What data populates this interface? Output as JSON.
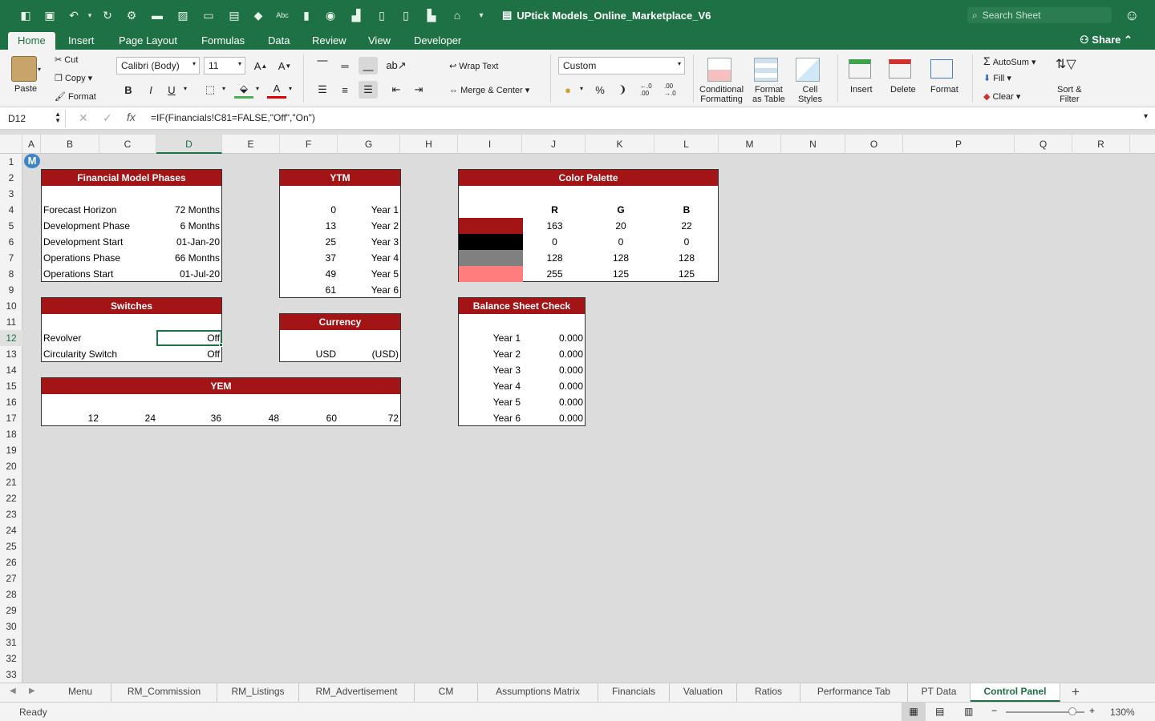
{
  "window": {
    "title": "UPtick Models_Online_Marketplace_V6",
    "search_placeholder": "Search Sheet"
  },
  "ribbon_tabs": [
    "Home",
    "Insert",
    "Page Layout",
    "Formulas",
    "Data",
    "Review",
    "View",
    "Developer"
  ],
  "active_tab": "Home",
  "share_label": "Share",
  "clipboard": {
    "paste": "Paste",
    "cut": "Cut",
    "copy": "Copy",
    "format": "Format"
  },
  "font": {
    "name": "Calibri (Body)",
    "size": "11",
    "bold": "B",
    "italic": "I",
    "underline": "U"
  },
  "alignment": {
    "wrap_text": "Wrap Text",
    "merge_center": "Merge & Center"
  },
  "number": {
    "format": "Custom",
    "percent": "%",
    "comma": "❩",
    "inc_decimal": "←.0 .00",
    "dec_decimal": ".00 →.0"
  },
  "styles": {
    "conditional": "Conditional\nFormatting",
    "format_table": "Format\nas Table",
    "cell_styles": "Cell\nStyles"
  },
  "cells_group": {
    "insert": "Insert",
    "delete": "Delete",
    "format": "Format"
  },
  "editing": {
    "autosum": "AutoSum",
    "fill": "Fill",
    "clear": "Clear",
    "sort_filter": "Sort &\nFilter"
  },
  "formula_bar": {
    "name_box": "D12",
    "fx": "fx",
    "formula": "=IF(Financials!C81=FALSE,\"Off\",\"On\")"
  },
  "columns": [
    "A",
    "B",
    "C",
    "D",
    "E",
    "F",
    "G",
    "H",
    "I",
    "J",
    "K",
    "L",
    "M",
    "N",
    "O",
    "P",
    "Q",
    "R"
  ],
  "selected_column": "D",
  "rows": [
    "1",
    "2",
    "3",
    "4",
    "5",
    "6",
    "7",
    "8",
    "9",
    "10",
    "11",
    "12",
    "13",
    "14",
    "15",
    "16",
    "17",
    "18",
    "19",
    "20",
    "21",
    "22",
    "23",
    "24",
    "25",
    "26",
    "27",
    "28",
    "29",
    "30",
    "31",
    "32",
    "33"
  ],
  "selected_row": "12",
  "m_badge": "M",
  "phases": {
    "title": "Financial Model Phases",
    "rows": [
      {
        "label": "Forecast Horizon",
        "value": "72 Months"
      },
      {
        "label": "Development Phase",
        "value": "6 Months"
      },
      {
        "label": "Development Start",
        "value": "01-Jan-20"
      },
      {
        "label": "Operations Phase",
        "value": "66 Months"
      },
      {
        "label": "Operations Start",
        "value": "01-Jul-20"
      }
    ]
  },
  "ytm": {
    "title": "YTM",
    "rows": [
      {
        "num": "0",
        "year": "Year 1"
      },
      {
        "num": "13",
        "year": "Year 2"
      },
      {
        "num": "25",
        "year": "Year 3"
      },
      {
        "num": "37",
        "year": "Year 4"
      },
      {
        "num": "49",
        "year": "Year 5"
      },
      {
        "num": "61",
        "year": "Year 6"
      }
    ]
  },
  "palette": {
    "title": "Color Palette",
    "headers": [
      "R",
      "G",
      "B"
    ],
    "rows": [
      {
        "swatch": "#a31416",
        "r": "163",
        "g": "20",
        "b": "22"
      },
      {
        "swatch": "#000000",
        "r": "0",
        "g": "0",
        "b": "0"
      },
      {
        "swatch": "#808080",
        "r": "128",
        "g": "128",
        "b": "128"
      },
      {
        "swatch": "#ff7d7d",
        "r": "255",
        "g": "125",
        "b": "125"
      }
    ]
  },
  "switches": {
    "title": "Switches",
    "rows": [
      {
        "label": "Revolver",
        "value": "Off"
      },
      {
        "label": "Circularity Switch",
        "value": "Off"
      }
    ]
  },
  "currency": {
    "title": "Currency",
    "code": "USD",
    "symbol": "(USD)"
  },
  "balance_check": {
    "title": "Balance Sheet Check",
    "rows": [
      {
        "year": "Year 1",
        "value": "0.000"
      },
      {
        "year": "Year 2",
        "value": "0.000"
      },
      {
        "year": "Year 3",
        "value": "0.000"
      },
      {
        "year": "Year 4",
        "value": "0.000"
      },
      {
        "year": "Year 5",
        "value": "0.000"
      },
      {
        "year": "Year 6",
        "value": "0.000"
      }
    ]
  },
  "yem": {
    "title": "YEM",
    "values": [
      "12",
      "24",
      "36",
      "48",
      "60",
      "72"
    ]
  },
  "sheet_tabs": [
    "Menu",
    "RM_Commission",
    "RM_Listings",
    "RM_Advertisement",
    "CM",
    "Assumptions Matrix",
    "Financials",
    "Valuation",
    "Ratios",
    "Performance Tab",
    "PT Data",
    "Control Panel"
  ],
  "active_sheet": "Control Panel",
  "status": {
    "ready": "Ready",
    "zoom": "130%"
  },
  "colors": {
    "excel_green": "#1e7145",
    "header_red": "#a31416"
  }
}
